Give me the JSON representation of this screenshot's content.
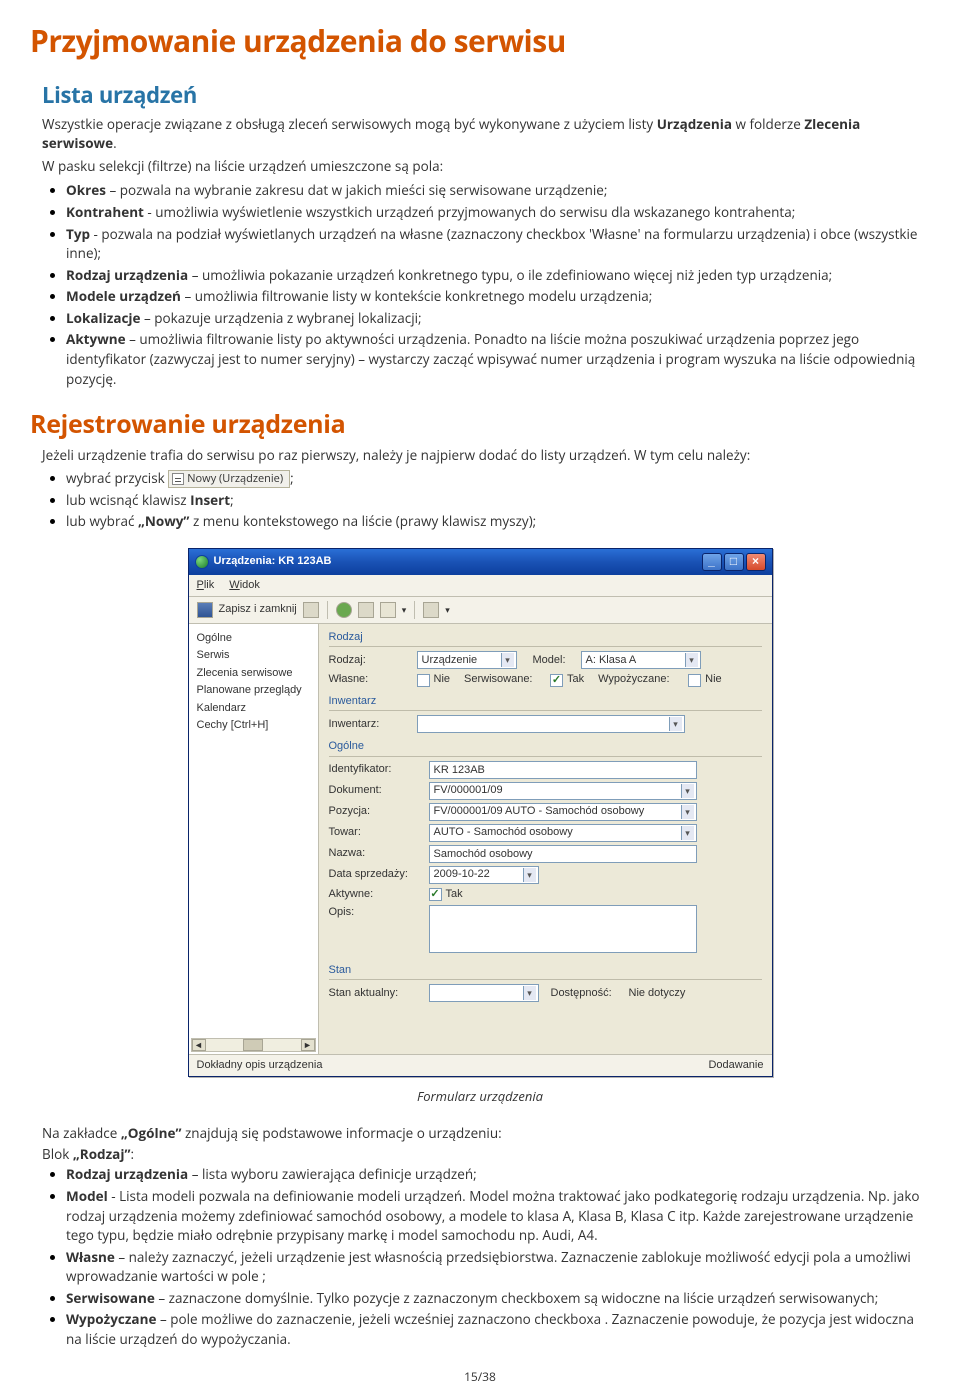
{
  "h1": "Przyjmowanie urządzenia do serwisu",
  "h2_list": "Lista urządzeń",
  "intro": {
    "pre": "Wszystkie operacje związane z obsługą zleceń serwisowych mogą być wykonywane z użyciem listy ",
    "b1": "Urządzenia",
    "mid": " w folderze ",
    "b2": "Zlecenia serwisowe",
    "post": "."
  },
  "filters_intro": "W pasku selekcji (filtrze) na liście urządzeń umieszczone są pola:",
  "filters": [
    {
      "b": "Okres",
      "t": " – pozwala na wybranie zakresu dat w jakich mieści się serwisowane urządzenie;"
    },
    {
      "b": "Kontrahent",
      "t": " - umożliwia wyświetlenie wszystkich urządzeń przyjmowanych do serwisu dla wskazanego kontrahenta;"
    },
    {
      "b": "Typ",
      "t": " - pozwala na podział wyświetlanych urządzeń na własne (zaznaczony checkbox 'Własne' na formularzu urządzenia) i obce (wszystkie inne);"
    },
    {
      "b": "Rodzaj urządzenia",
      "t": " – umożliwia pokazanie urządzeń konkretnego typu, o ile zdefiniowano więcej niż jeden typ urządzenia;"
    },
    {
      "b": "Modele urządzeń",
      "t": " – umożliwia filtrowanie listy w kontekście konkretnego modelu urządzenia;"
    },
    {
      "b": "Lokalizacje",
      "t": " – pokazuje urządzenia z wybranej lokalizacji;"
    },
    {
      "b": "Aktywne",
      "t": " – umożliwia filtrowanie listy po aktywności urządzenia. Ponadto na liście można poszukiwać urządzenia poprzez jego identyfikator (zazwyczaj jest to numer seryjny) – wystarczy zacząć wpisywać numer urządzenia i program wyszuka na liście odpowiednią pozycję."
    }
  ],
  "h2_reg": "Rejestrowanie urządzenia",
  "reg_intro": "Jeżeli urządzenie trafia do serwisu po raz pierwszy, należy je najpierw dodać do listy urządzeń. W tym celu należy:",
  "reg_bullets": {
    "a_pre": "wybrać przycisk ",
    "a_btn": "Nowy (Urządzenie)",
    "a_post": ";",
    "b_pre": "lub wcisnąć klawisz ",
    "b_b": "Insert",
    "b_post": ";",
    "c_pre": "lub wybrać ",
    "c_b": "„Nowy”",
    "c_post": " z menu kontekstowego na liście (prawy klawisz myszy);"
  },
  "win": {
    "title": "Urządzenia: KR 123AB",
    "menu": {
      "plik": "Plik",
      "widok": "Widok"
    },
    "tool_save": "Zapisz i zamknij",
    "side": [
      "Ogólne",
      "Serwis",
      "Zlecenia serwisowe",
      "Planowane przeglądy",
      "Kalendarz",
      "Cechy [Ctrl+H]"
    ],
    "g_rodzaj": "Rodzaj",
    "l_rodzaj": "Rodzaj:",
    "v_rodzaj": "Urządzenie",
    "l_model": "Model:",
    "v_model": "A: Klasa A",
    "l_wlasne": "Własne:",
    "v_wlasne": "Nie",
    "l_serw": "Serwisowane:",
    "v_serw": "Tak",
    "l_wyp": "Wypożyczane:",
    "v_wyp": "Nie",
    "g_inwent": "Inwentarz",
    "l_inwent": "Inwentarz:",
    "g_ogolne": "Ogólne",
    "l_ident": "Identyfikator:",
    "v_ident": "KR 123AB",
    "l_dok": "Dokument:",
    "v_dok": "FV/000001/09",
    "l_poz": "Pozycja:",
    "v_poz": "FV/000001/09 AUTO - Samochód osobowy",
    "l_towar": "Towar:",
    "v_towar": "AUTO - Samochód osobowy",
    "l_nazwa": "Nazwa:",
    "v_nazwa": "Samochód osobowy",
    "l_data": "Data sprzedaży:",
    "v_data": "2009-10-22",
    "l_akt": "Aktywne:",
    "v_akt": "Tak",
    "l_opis": "Opis:",
    "g_stan": "Stan",
    "l_stan": "Stan aktualny:",
    "l_dost": "Dostępność:",
    "v_dost": "Nie dotyczy",
    "status_l": "Dokładny opis urządzenia",
    "status_r": "Dodawanie"
  },
  "caption": "Formularz urządzenia",
  "after1_pre": "Na zakładce ",
  "after1_b": "„Ogólne”",
  "after1_post": " znajdują się podstawowe informacje o urządzeniu:",
  "after2_pre": "Blok ",
  "after2_b": "„Rodzaj”",
  "after2_post": ":",
  "block_items": [
    {
      "b": "Rodzaj urządzenia",
      "t": " – lista wyboru zawierająca definicje urządzeń;"
    },
    {
      "b": "Model",
      "t": " - Lista modeli pozwala na definiowanie modeli urządzeń. Model można traktować jako podkategorię rodzaju urządzenia. Np. jako rodzaj urządzenia możemy zdefiniować samochód osobowy, a modele to klasa A, Klasa B, Klasa C itp. Każde zarejestrowane urządzenie tego typu, będzie miało odrębnie przypisany markę i model samochodu np. Audi, A4."
    },
    {
      "b": "Własne",
      "t": " – należy zaznaczyć, jeżeli urządzenie jest własnością przedsiębiorstwa. Zaznaczenie zablokuje możliwość edycji pola a umożliwi wprowadzanie wartości w pole ;"
    },
    {
      "b": "Serwisowane",
      "t": " – zaznaczone domyślnie. Tylko pozycje z zaznaczonym checkboxem są widoczne na liście urządzeń serwisowanych;"
    },
    {
      "b": "Wypożyczane",
      "t": " – pole możliwe do zaznaczenie, jeżeli wcześniej zaznaczono checkboxa . Zaznaczenie powoduje, że pozycja jest widoczna na liście urządzeń do wypożyczania."
    }
  ],
  "pagenum": "15/38"
}
